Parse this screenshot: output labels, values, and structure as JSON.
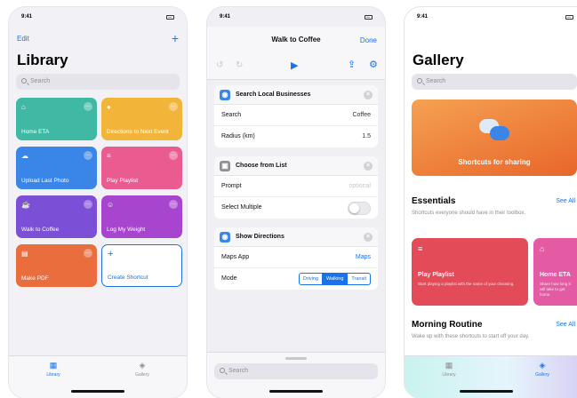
{
  "status": {
    "time": "9:41"
  },
  "library": {
    "edit_label": "Edit",
    "add_label": "+",
    "title": "Library",
    "search_placeholder": "Search",
    "tiles": [
      {
        "label": "Home ETA",
        "color": "#3fb8a4",
        "icon": "house-icon"
      },
      {
        "label": "Directions to Next Event",
        "color": "#f2b53a",
        "icon": "pin-icon"
      },
      {
        "label": "Upload Last Photo",
        "color": "#3a86e8",
        "icon": "cloud-icon"
      },
      {
        "label": "Play Playlist",
        "color": "#ea5c90",
        "icon": "list-icon"
      },
      {
        "label": "Walk to Coffee",
        "color": "#7b4fd6",
        "icon": "cup-icon"
      },
      {
        "label": "Log My Weight",
        "color": "#a745cf",
        "icon": "figure-icon"
      },
      {
        "label": "Make PDF",
        "color": "#e96d3d",
        "icon": "doc-icon"
      },
      {
        "label": "Create Shortcut",
        "color": "#ffffff",
        "icon": "plus-icon"
      }
    ],
    "tabs": [
      {
        "label": "Library"
      },
      {
        "label": "Gallery"
      }
    ]
  },
  "editor": {
    "title": "Walk to Coffee",
    "done_label": "Done",
    "actions": [
      {
        "title": "Search Local Businesses",
        "icon_color": "#3a86e8",
        "rows": [
          {
            "label": "Search",
            "value": "Coffee",
            "style": "value"
          },
          {
            "label": "Radius (km)",
            "value": "1.5",
            "style": "value"
          }
        ]
      },
      {
        "title": "Choose from List",
        "icon_color": "#8e8e93",
        "rows": [
          {
            "label": "Prompt",
            "value": "optional",
            "style": "placeholder"
          },
          {
            "label": "Select Multiple",
            "value": "",
            "style": "toggle"
          }
        ]
      },
      {
        "title": "Show Directions",
        "icon_color": "#3a86e8",
        "rows": [
          {
            "label": "Maps App",
            "value": "Maps",
            "style": "link"
          },
          {
            "label": "Mode",
            "value": "",
            "style": "segment",
            "options": [
              "Driving",
              "Walking",
              "Transit"
            ],
            "selected": "Walking"
          }
        ]
      }
    ],
    "search_placeholder": "Search"
  },
  "gallery": {
    "title": "Gallery",
    "search_placeholder": "Search",
    "banner_label": "Shortcuts for sharing",
    "essentials": {
      "title": "Essentials",
      "see_all": "See All",
      "subtitle": "Shortcuts everyone should have in their toolbox.",
      "cards": [
        {
          "label": "Play Playlist",
          "sub": "Start playing a playlist with the name of your choosing.",
          "color": "#e24b57"
        },
        {
          "label": "Home ETA",
          "sub": "Share how long it will take to get home.",
          "color": "#e45aa3"
        }
      ]
    },
    "morning": {
      "title": "Morning Routine",
      "see_all": "See All",
      "subtitle": "Wake up with these shortcuts to start off your day."
    },
    "tabs": [
      {
        "label": "Library"
      },
      {
        "label": "Gallery"
      }
    ]
  }
}
